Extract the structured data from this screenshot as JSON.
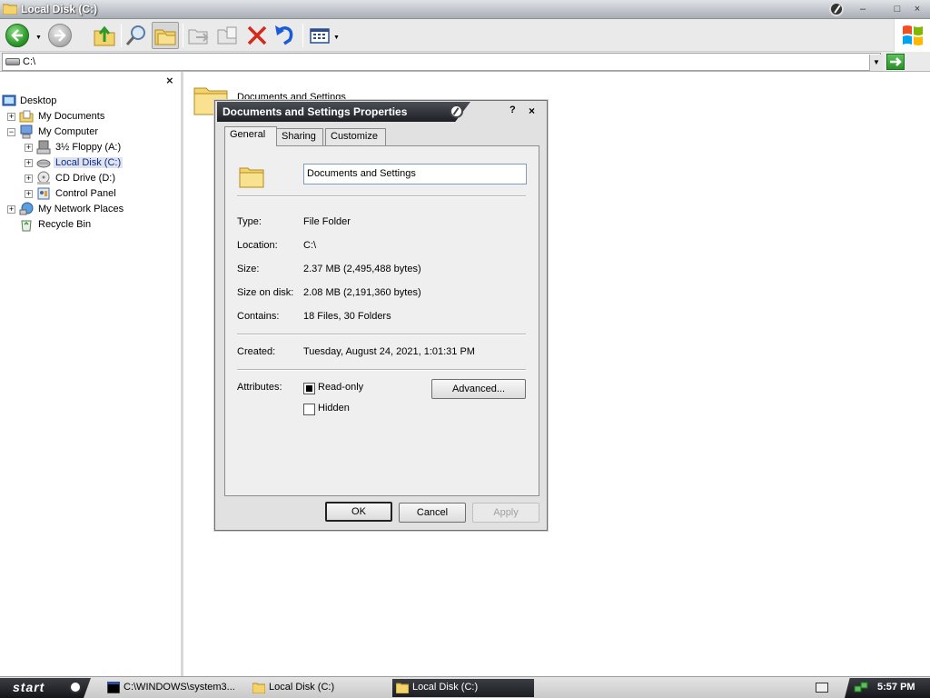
{
  "window": {
    "title": "Local Disk (C:)"
  },
  "address": {
    "value": "C:\\"
  },
  "tree": {
    "items": [
      {
        "label": "Desktop"
      },
      {
        "label": "My Documents"
      },
      {
        "label": "My Computer"
      },
      {
        "label": "3½ Floppy (A:)"
      },
      {
        "label": "Local Disk (C:)"
      },
      {
        "label": "CD Drive (D:)"
      },
      {
        "label": "Control Panel"
      },
      {
        "label": "My Network Places"
      },
      {
        "label": "Recycle Bin"
      }
    ],
    "close_glyph": "×"
  },
  "content": {
    "folder_label": "Documents and Settings"
  },
  "dialog": {
    "title": "Documents and Settings Properties",
    "help": "?",
    "close": "×",
    "tabs": [
      "General",
      "Sharing",
      "Customize"
    ],
    "name_value": "Documents and Settings",
    "properties": [
      {
        "label": "Type:",
        "value": "File Folder"
      },
      {
        "label": "Location:",
        "value": "C:\\"
      },
      {
        "label": "Size:",
        "value": "2.37 MB (2,495,488 bytes)"
      },
      {
        "label": "Size on disk:",
        "value": "2.08 MB (2,191,360 bytes)"
      },
      {
        "label": "Contains:",
        "value": "18 Files, 30 Folders"
      },
      {
        "label": "Created:",
        "value": "Tuesday, August 24, 2021, 1:01:31 PM"
      }
    ],
    "attributes_label": "Attributes:",
    "readonly_label": "Read-only",
    "hidden_label": "Hidden",
    "readonly_checked": true,
    "hidden_checked": false,
    "advanced_label": "Advanced...",
    "ok_label": "OK",
    "cancel_label": "Cancel",
    "apply_label": "Apply"
  },
  "taskbar": {
    "start_label": "start",
    "tasks": [
      {
        "label": "C:\\WINDOWS\\system3..."
      },
      {
        "label": "Local Disk (C:)"
      },
      {
        "label": "Local Disk (C:)"
      }
    ],
    "clock": "5:57 PM"
  },
  "colors": {
    "selection": "#dfe3ee",
    "title_dark": "#1d2025",
    "back_green": "#2e9a2c",
    "delete_red": "#d42a1a",
    "undo_blue": "#1a5bd8"
  },
  "icons": [
    "back-icon",
    "forward-icon",
    "up-folder-icon",
    "search-icon",
    "folders-icon",
    "move-to-icon",
    "copy-to-icon",
    "delete-icon",
    "undo-icon",
    "views-icon",
    "windows-logo-icon"
  ]
}
